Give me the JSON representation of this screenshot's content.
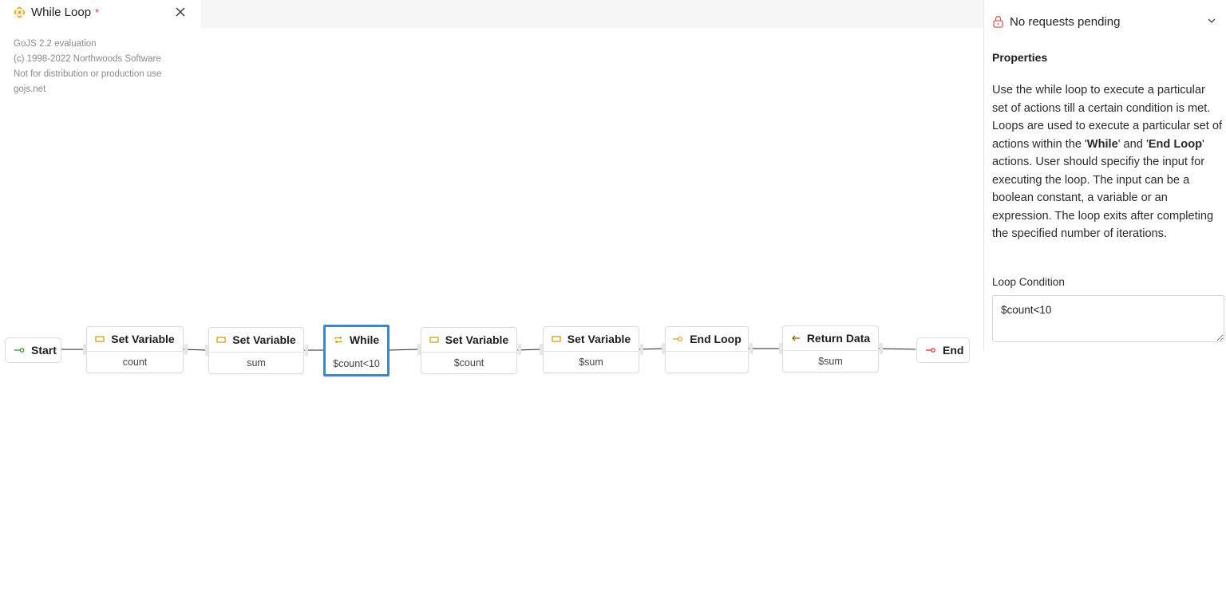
{
  "tab": {
    "title": "While Loop",
    "dirty_marker": "*",
    "icon": "workflow-icon",
    "close_icon": "close-icon"
  },
  "watermark": {
    "line1": "GoJS 2.2 evaluation",
    "line2": "(c) 1998-2022 Northwoods Software",
    "line3": "Not for distribution or production use",
    "line4": "gojs.net"
  },
  "flow": {
    "start": {
      "label": "Start",
      "icon": "start-arrow-icon"
    },
    "nodes": [
      {
        "title": "Set Variable",
        "value": "count",
        "icon": "variable-icon"
      },
      {
        "title": "Set Variable",
        "value": "sum",
        "icon": "variable-icon"
      },
      {
        "title": "While",
        "value": "$count<10",
        "icon": "loop-icon"
      },
      {
        "title": "Set Variable",
        "value": "$count",
        "icon": "variable-icon"
      },
      {
        "title": "Set Variable",
        "value": "$sum",
        "icon": "variable-icon"
      },
      {
        "title": "End Loop",
        "value": "",
        "icon": "end-loop-icon"
      },
      {
        "title": "Return Data",
        "value": "$sum",
        "icon": "return-icon"
      }
    ],
    "end": {
      "label": "End",
      "icon": "end-arrow-icon"
    }
  },
  "requests": {
    "label": "No requests pending",
    "icon": "lock-icon"
  },
  "properties": {
    "title": "Properties",
    "description_parts": [
      "Use the while loop to execute a particular set of actions till a certain condition is met. Loops are used to execute a particular set of actions within the '",
      "While",
      "' and '",
      "End Loop",
      "' actions. User should specifiy the input for executing the loop. The input can be a boolean constant, a variable or an expression. The loop exits after completing the specified number of iterations."
    ],
    "condition_label": "Loop Condition",
    "condition_value": "$count<10"
  },
  "colors": {
    "accent_selected": "#2a8be0",
    "icon_yellow": "#d4a017",
    "icon_green": "#3a9a3a",
    "icon_red": "#e53935",
    "lock_red": "#e05a5a"
  }
}
